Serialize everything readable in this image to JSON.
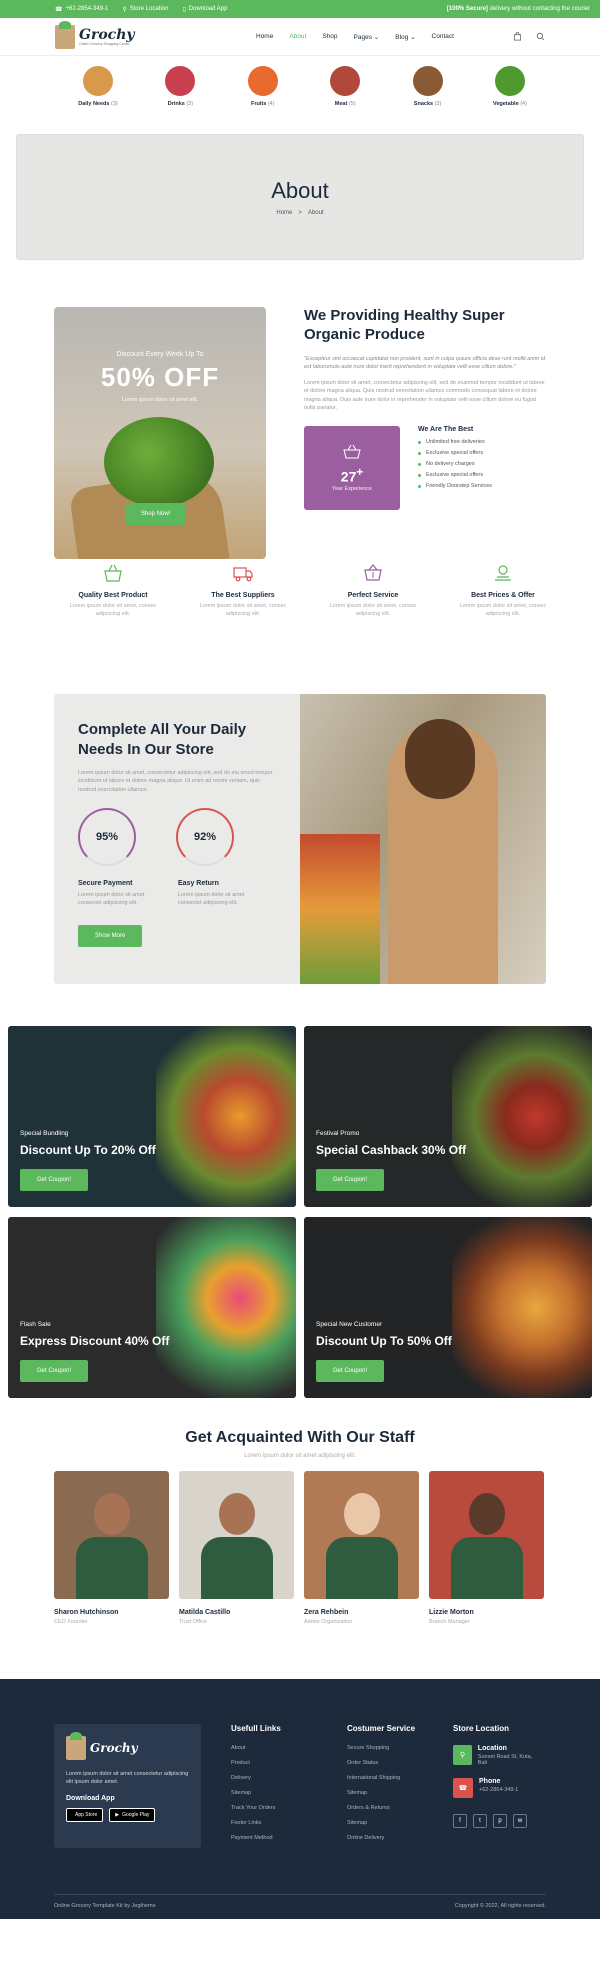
{
  "topbar": {
    "phone": "+62-2854-349-1",
    "store": "Store Location",
    "app": "Download App",
    "promo_bold": "[100% Secure]",
    "promo_rest": " delivery without contacting the courier"
  },
  "brand": {
    "name": "Grochy",
    "tagline": "Online Grocery Shopping Center"
  },
  "nav": [
    "Home",
    "About",
    "Shop",
    "Pages",
    "Blog",
    "Contact"
  ],
  "categories": [
    {
      "label": "Daily Needs",
      "count": "(3)",
      "color": "#d89a4a"
    },
    {
      "label": "Drinks",
      "count": "(3)",
      "color": "#c93f4f"
    },
    {
      "label": "Fruits",
      "count": "(4)",
      "color": "#e86a2e"
    },
    {
      "label": "Meat",
      "count": "(5)",
      "color": "#b2483c"
    },
    {
      "label": "Snacks",
      "count": "(3)",
      "color": "#8a5a34"
    },
    {
      "label": "Vegetable",
      "count": "(4)",
      "color": "#4f9a2e"
    }
  ],
  "banner": {
    "title": "About",
    "crumb_home": "Home",
    "crumb_sep": ">",
    "crumb_current": "About"
  },
  "promo": {
    "line1": "Discount Every Week Up To",
    "big": "50% OFF",
    "sub": "Lorem ipsum dolor sit amet elit.",
    "button": "Shop Now!"
  },
  "about": {
    "title": "We Providing Healthy Super Organic Produce",
    "quote": "\"Excepteur sint occaecat cupidatat non proident, sunt in culpa quiure officia dese runt mollit anim id est laborumuis aute irure dolor inerit reprehenderit in voluptate velit esse cillum dolore.\"",
    "lead": "Lorem ipsum dolor sit amet, consectetur adipiscing elit, sed do eiusmod tempor incididunt ut labore et dolore magna aliqua. Quis nostrud exercitation ullamco commodo consequat labore et dolore magna aliqua. Duis aute irure dolor in reprehender in voluptate velit esse cillum dolore eu fugiat nulla pariatur.",
    "exp_num": "27",
    "exp_sup": "+",
    "exp_cap": "Year Experience",
    "best_title": "We Are The Best",
    "best_items": [
      "Unlimited free deliveries",
      "Exclusive special offers",
      "No delivery charges",
      "Exclusive special offers",
      "Friendly Doorstep Services"
    ]
  },
  "features": [
    {
      "title": "Quality Best Product",
      "desc": "Lorem ipsum dolor sit amet, consec adipiscing elit.",
      "icon": "basket-icon"
    },
    {
      "title": "The Best Suppliers",
      "desc": "Lorem ipsum dolor sit amet, consec adipiscing elit.",
      "icon": "truck-icon"
    },
    {
      "title": "Perfect Service",
      "desc": "Lorem ipsum dolor sit amet, consec adipiscing elit.",
      "icon": "cart-icon"
    },
    {
      "title": "Best Prices & Offer",
      "desc": "Lorem ipsum dolor sit amet, consec adipiscing elit.",
      "icon": "price-icon"
    }
  ],
  "complete": {
    "title": "Complete All Your Daily Needs In Our Store",
    "desc": "Lorem ipsum dolor sit amet, consectetur adipiscing elit, sed do eiu smod tempor incididunt ut labore et dolore magna aliqua. Ut enim ad minim veniam, quis nostrud exercitation ullamco.",
    "ring1": "95%",
    "ring2": "92%",
    "cap1_title": "Secure Payment",
    "cap1_desc": "Lorem ipsum dolor sit amet consectet adipiscing elit.",
    "cap2_title": "Easy Return",
    "cap2_desc": "Lorem ipsum dolor sit amet consectet adipiscing elit.",
    "button": "Show More"
  },
  "deals": [
    {
      "kicker": "Special Bundling",
      "title": "Discount Up To 20% Off",
      "button": "Get Coupon!",
      "bg": "#1f3237"
    },
    {
      "kicker": "Festival Promo",
      "title": "Special Cashback 30% Off",
      "button": "Get Coupon!",
      "bg": "#252828"
    },
    {
      "kicker": "Flash Sale",
      "title": "Express Discount 40% Off",
      "button": "Get Coupon!",
      "bg": "#2b2b2b"
    },
    {
      "kicker": "Special New Customer",
      "title": "Discount Up To 50% Off",
      "button": "Get Coupon!",
      "bg": "#232426"
    }
  ],
  "staff": {
    "title": "Get Acquainted With Our Staff",
    "sub": "Lorem ipsum dolor sit amet adipiscing elit.",
    "members": [
      {
        "name": "Sharon Hutchinson",
        "role": "CEO Founder",
        "bg": "#8b6a52"
      },
      {
        "name": "Matilda Castillo",
        "role": "Trust Office",
        "bg": "#d8d4cc"
      },
      {
        "name": "Zera Rehbein",
        "role": "Admin Organization",
        "bg": "#b07a54"
      },
      {
        "name": "Lizzie Morton",
        "role": "Branch Manager",
        "bg": "#b84a3e"
      }
    ]
  },
  "footer": {
    "desc": "Lorem ipsum dolor sit amet consectetur adipiscing elit ipsum dolor amet.",
    "download": "Download App",
    "appstore": "App Store",
    "googleplay": "Google Play",
    "col1_title": "Usefull Links",
    "col1": [
      "About",
      "Product",
      "Delivery",
      "Sitemap",
      "Track Your Orders",
      "Footer Links",
      "Payment Method"
    ],
    "col2_title": "Costumer Service",
    "col2": [
      "Secure Shopping",
      "Order Status",
      "International Shipping",
      "Sitemap",
      "Orders & Returns",
      "Sitemap",
      "Online Delivery"
    ],
    "col3_title": "Store Location",
    "loc_title": "Location",
    "loc_value": "Sunset Road St, Kuta, Bali",
    "phone_title": "Phone",
    "phone_value": "+62-2864-349-1",
    "socials": [
      "f",
      "t",
      "p",
      "w"
    ],
    "copy_left": "Online Grocery Template Kit by Jegtheme",
    "copy_right": "Copyright © 2022, All rights reserved."
  }
}
